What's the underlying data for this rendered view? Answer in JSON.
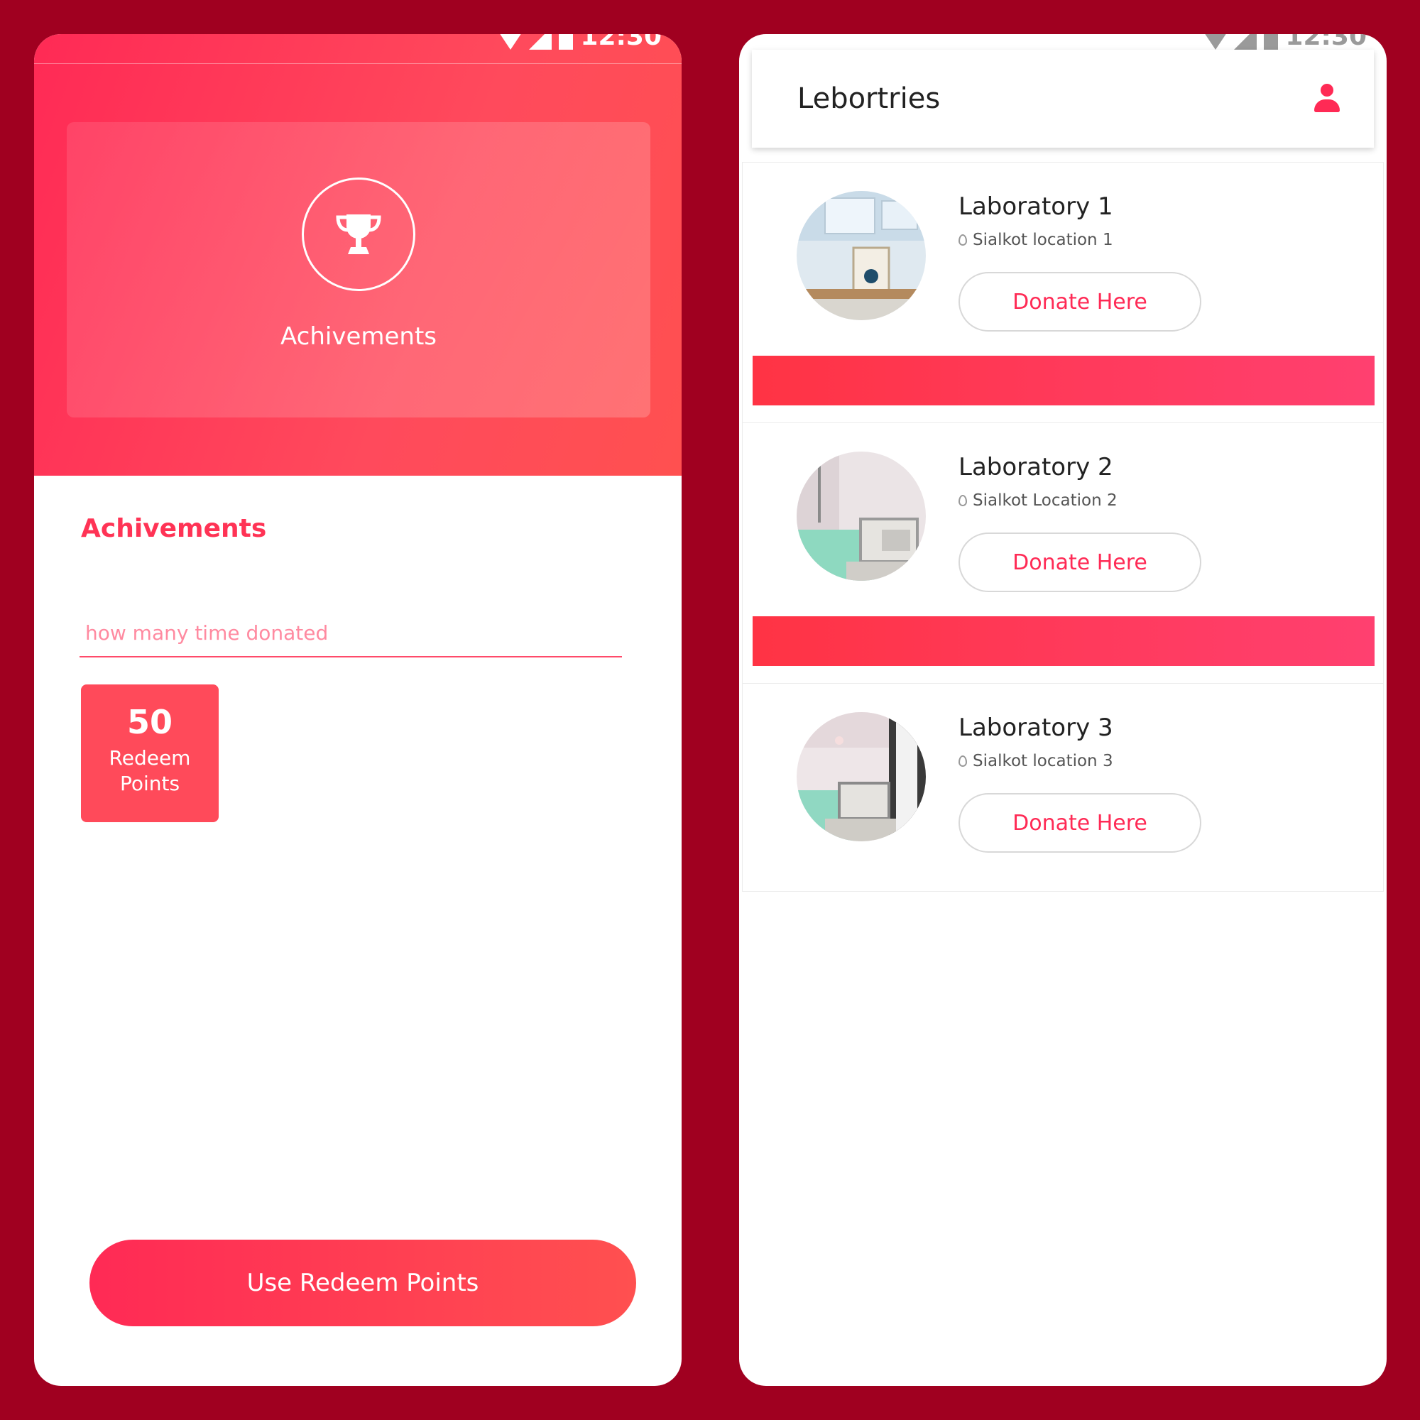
{
  "left_screen": {
    "status_time": "12:30",
    "hero_title": "Achivements",
    "section_title": "Achivements",
    "input_placeholder": "how many time donated",
    "points": {
      "value": "50",
      "label": "Redeem Points"
    },
    "redeem_button_label": "Use Redeem Points",
    "colors": {
      "accent": "#ff2a55",
      "background": "#a00020"
    },
    "icons": {
      "hero": "trophy-icon"
    }
  },
  "right_screen": {
    "status_time": "12:30",
    "app_bar_title": "Lebortries",
    "labs": [
      {
        "name": "Laboratory 1",
        "location": "Sialkot location 1",
        "button_label": "Donate Here"
      },
      {
        "name": "Laboratory 2",
        "location": "Sialkot Location 2",
        "button_label": "Donate Here"
      },
      {
        "name": "Laboratory 3",
        "location": "Sialkot location 3",
        "button_label": "Donate Here"
      }
    ],
    "icons": {
      "profile": "user-icon",
      "location": "location-pin-icon"
    }
  }
}
